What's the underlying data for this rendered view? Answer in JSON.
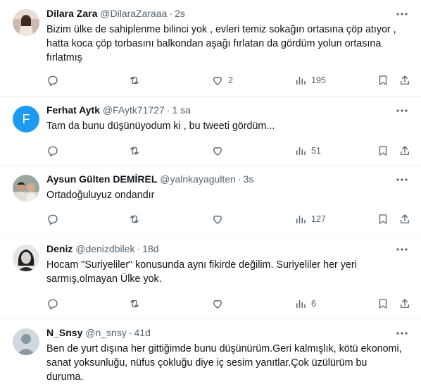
{
  "tweets": [
    {
      "name": "Dilara Zara",
      "handle": "@DilaraZaraaa",
      "time": "2s",
      "text": "Bizim ülke de sahiplenme bilinci yok , evleri temiz sokağın ortasına çöp atıyor , hatta koca çöp torbasını balkondan aşağı fırlatan da gördüm yolun ortasına fırlatmış",
      "likes": "2",
      "views": "195"
    },
    {
      "name": "Ferhat Aytk",
      "handle": "@FAytk71727",
      "time": "1 sa",
      "text": "Tam da bunu düşünüyodum ki , bu tweeti gördüm...",
      "avatar_letter": "F",
      "views": "51"
    },
    {
      "name": "Aysun Gülten DEMİREL",
      "handle": "@yalnkayagulten",
      "time": "3s",
      "text": "Ortadoğuluyuz ondandır",
      "views": "127"
    },
    {
      "name": "Deniz",
      "handle": "@denizdbilek",
      "time": "18d",
      "text": "Hocam \"Suriyeliler\" konusunda aynı fikirde değilim. Suriyeliler her yeri sarmış,olmayan Ülke yok.",
      "views": "6"
    },
    {
      "name": "N_Snsy",
      "handle": "@n_snsy",
      "time": "41d",
      "text": "Ben de yurt dışına her gittiğimde bunu düşünürüm.Geri kalmışlık, kötü ekonomi, sanat yoksunluğu, nüfus çokluğu diye iç sesim yanıtlar.Çok üzülürüm bu duruma."
    }
  ],
  "colors": {
    "accent": "#1d9bf0",
    "muted": "#536471",
    "text": "#0f1419",
    "divider": "#eff3f4"
  },
  "icons": [
    "more-icon",
    "reply-icon",
    "retweet-icon",
    "like-icon",
    "views-icon",
    "bookmark-icon",
    "share-icon"
  ]
}
